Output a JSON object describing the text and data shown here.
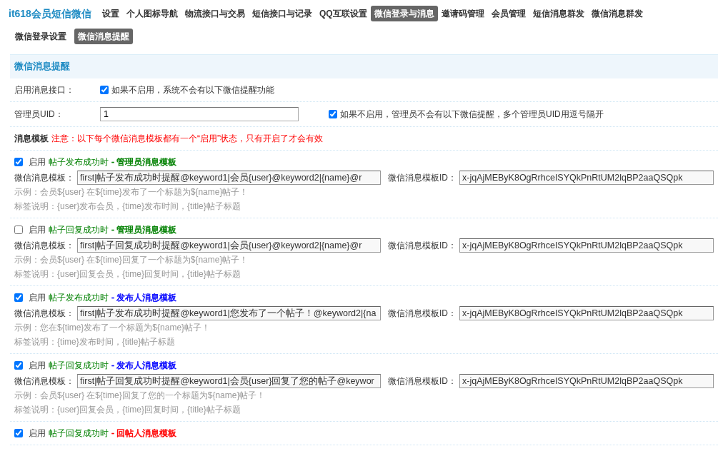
{
  "nav": {
    "brand": "it618会员短信微信",
    "items": [
      {
        "label": "设置",
        "selected": false
      },
      {
        "label": "个人图标导航",
        "selected": false
      },
      {
        "label": "物流接口与交易",
        "selected": false
      },
      {
        "label": "短信接口与记录",
        "selected": false
      },
      {
        "label": "QQ互联设置",
        "selected": false
      },
      {
        "label": "微信登录与消息",
        "selected": true
      },
      {
        "label": "邀请码管理",
        "selected": false
      },
      {
        "label": "会员管理",
        "selected": false
      },
      {
        "label": "短信消息群发",
        "selected": false
      },
      {
        "label": "微信消息群发",
        "selected": false
      }
    ]
  },
  "subtabs": [
    {
      "label": "微信登录设置",
      "selected": false
    },
    {
      "label": "微信消息提醒",
      "selected": true
    }
  ],
  "section_title": "微信消息提醒",
  "settings": [
    {
      "kind": "checkbox",
      "label": "启用消息接口：",
      "checked": true,
      "hint": "如果不启用，系统不会有以下微信提醒功能"
    },
    {
      "kind": "text_checkbox",
      "label": "管理员UID：",
      "value": "1",
      "checked": true,
      "hint": "如果不启用，管理员不会有以下微信提醒，多个管理员UID用逗号隔开"
    }
  ],
  "notice": {
    "title": "消息模板",
    "text": "注意：以下每个微信消息模板都有一个“启用”状态，只有开启了才会有效"
  },
  "templates": [
    {
      "enabled": true,
      "enable_label": "启用",
      "event": "帖子发布成功时",
      "recipient": "- 管理员消息模板",
      "color": "#008000",
      "template_label": "微信消息模板：",
      "template_value": "first|帖子发布成功时提醒@keyword1|会员{user}@keyword2|{name}@r",
      "id_label": "微信消息模板ID：",
      "id_value": "x-jqAjMEByK8OgRrhceISYQkPnRtUM2lqBP2aaQSQpk",
      "example": "示例：会员${user} 在${time}发布了一个标题为${name}帖子！",
      "tags": "标签说明：{user}发布会员，{time}发布时间，{title}帖子标题"
    },
    {
      "enabled": false,
      "enable_label": "启用",
      "event": "帖子回复成功时",
      "recipient": "- 管理员消息模板",
      "color": "#008000",
      "template_label": "微信消息模板：",
      "template_value": "first|帖子回复成功时提醒@keyword1|会员{user}@keyword2|{name}@r",
      "id_label": "微信消息模板ID：",
      "id_value": "x-jqAjMEByK8OgRrhceISYQkPnRtUM2lqBP2aaQSQpk",
      "example": "示例：会员${user} 在${time}回复了一个标题为${name}帖子！",
      "tags": "标签说明：{user}回复会员，{time}回复时间，{title}帖子标题"
    },
    {
      "enabled": true,
      "enable_label": "启用",
      "event": "帖子发布成功时",
      "recipient": "- 发布人消息模板",
      "color": "#0000ff",
      "template_label": "微信消息模板：",
      "template_value": "first|帖子发布成功时提醒@keyword1|您发布了一个帖子！@keyword2|{na",
      "id_label": "微信消息模板ID：",
      "id_value": "x-jqAjMEByK8OgRrhceISYQkPnRtUM2lqBP2aaQSQpk",
      "example": "示例：您在${time}发布了一个标题为${name}帖子！",
      "tags": "标签说明：{time}发布时间，{title}帖子标题"
    },
    {
      "enabled": true,
      "enable_label": "启用",
      "event": "帖子回复成功时",
      "recipient": "- 发布人消息模板",
      "color": "#0000ff",
      "template_label": "微信消息模板：",
      "template_value": "first|帖子回复成功时提醒@keyword1|会员{user}回复了您的帖子@keywor",
      "id_label": "微信消息模板ID：",
      "id_value": "x-jqAjMEByK8OgRrhceISYQkPnRtUM2lqBP2aaQSQpk",
      "example": "示例：会员${user} 在${time}回复了您的一个标题为${name}帖子！",
      "tags": "标签说明：{user}回复会员，{time}回复时间，{title}帖子标题"
    },
    {
      "enabled": true,
      "enable_label": "启用",
      "event": "帖子回复成功时",
      "recipient": "- 回帖人消息模板",
      "color": "#ff0000"
    }
  ]
}
